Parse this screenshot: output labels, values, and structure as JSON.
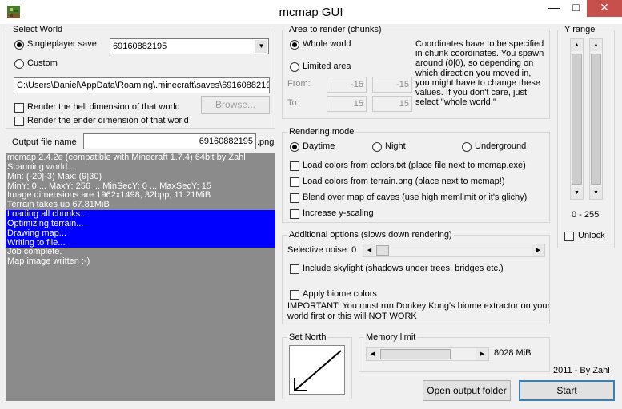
{
  "window": {
    "title": "mcmap GUI",
    "minimize": "—",
    "maximize": "□",
    "close": "✕"
  },
  "select_world": {
    "title": "Select World",
    "singleplayer_label": "Singleplayer save",
    "save_value": "69160882195",
    "custom_label": "Custom",
    "path_value": "C:\\Users\\Daniel\\AppData\\Roaming\\.minecraft\\saves\\69160882195",
    "hell_label": "Render the hell dimension of that world",
    "ender_label": "Render the ender dimension of that world",
    "browse_label": "Browse..."
  },
  "output": {
    "label": "Output file name",
    "value": "69160882195",
    "extension": ".png"
  },
  "log": {
    "lines": [
      "mcmap 2.4.2e (compatible with Minecraft 1.7.4) 64bit by Zahl",
      "Scanning world...",
      "Min: (-20|-3) Max: (9|30)",
      "MinY: 0 ... MaxY: 256 ... MinSecY: 0 ... MaxSecY: 15",
      "Image dimensions are 1962x1498, 32bpp, 11.21MiB",
      "Terrain takes up 67.81MiB",
      "Loading all chunks..",
      "Optimizing terrain...",
      "Drawing map...",
      "Writing to file...",
      "Job complete.",
      "Map image written :-)"
    ],
    "highlighted": [
      6,
      7,
      8,
      9
    ]
  },
  "area": {
    "title": "Area to render (chunks)",
    "whole_world_label": "Whole world",
    "limited_label": "Limited area",
    "from_label": "From:",
    "to_label": "To:",
    "from_x": "-15",
    "from_z": "-15",
    "to_x": "15",
    "to_z": "15",
    "help_lines": [
      "Coordinates have to be specified",
      "in chunk coordinates. You spawn",
      "around (0|0), so depending on",
      "which direction you moved in,",
      "you might have to change these",
      "values. If you don't care, just",
      "select \"whole world.\""
    ]
  },
  "rendering": {
    "title": "Rendering mode",
    "daytime_label": "Daytime",
    "night_label": "Night",
    "underground_label": "Underground",
    "load_colors_label": "Load colors from colors.txt (place file next to mcmap.exe)",
    "load_terrain_label": "Load colors from terrain.png (place next to mcmap!)",
    "blend_label": "Blend over map of caves (use high memlimit or it's glichy)",
    "yscale_label": "Increase y-scaling"
  },
  "additional": {
    "title": "Additional options (slows down rendering)",
    "noise_label": "Selective noise: 0",
    "noise_value": 0,
    "skylight_label": "Include skylight (shadows under trees, bridges etc.)",
    "biome_label": "Apply biome colors",
    "important_lines": [
      "IMPORTANT: You must run Donkey Kong's biome extractor on your",
      "world first or this will NOT WORK"
    ]
  },
  "y_range": {
    "title": "Y range",
    "range_label": "0 - 255",
    "min": 0,
    "max": 255,
    "unlock_label": "Unlock"
  },
  "set_north": {
    "title": "Set North",
    "direction": "south-west"
  },
  "memory": {
    "title": "Memory limit",
    "value_label": "8028 MiB",
    "value": 8028
  },
  "footer": {
    "credit": "2011 - By Zahl",
    "open_output_label": "Open output folder",
    "start_label": "Start"
  },
  "icons": {
    "app": "mcmap-app-icon",
    "combo": "chevron-down-icon",
    "arrow": "north-arrow-icon"
  }
}
